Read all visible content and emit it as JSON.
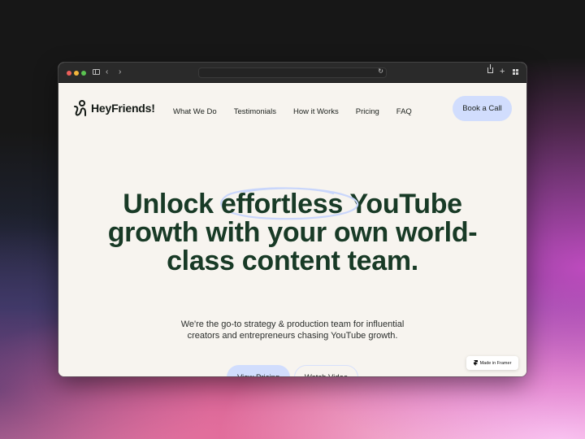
{
  "browser": {
    "address_text": "",
    "icons": [
      "sidebar-toggle-icon",
      "back-icon",
      "forward-icon",
      "reload-icon",
      "share-icon",
      "new-tab-icon",
      "tab-overview-icon"
    ],
    "back_glyph": "‹",
    "forward_glyph": "›",
    "reload_glyph": "↻",
    "plus_glyph": "+"
  },
  "site": {
    "logo_text": "HeyFriends!",
    "nav": [
      "What We Do",
      "Testimonials",
      "How it Works",
      "Pricing",
      "FAQ"
    ],
    "cta_label": "Book a Call",
    "hero": {
      "line1_before": "Unlock ",
      "highlight": "effortless",
      "line1_after": " YouTube",
      "line2": "growth with your own world-",
      "line3": "class content team."
    },
    "subtitle_line1": "We're the go-to strategy & production team for influential",
    "subtitle_line2": "creators and entrepreneurs chasing YouTube growth.",
    "buttons": {
      "primary": "View Pricing",
      "secondary": "Watch Video"
    },
    "badge": "Made in Framer"
  },
  "colors": {
    "heading": "#183a26",
    "accent": "#d1ddfd",
    "page_bg": "#f7f4ef",
    "toolbar": "#2a2a2a"
  }
}
